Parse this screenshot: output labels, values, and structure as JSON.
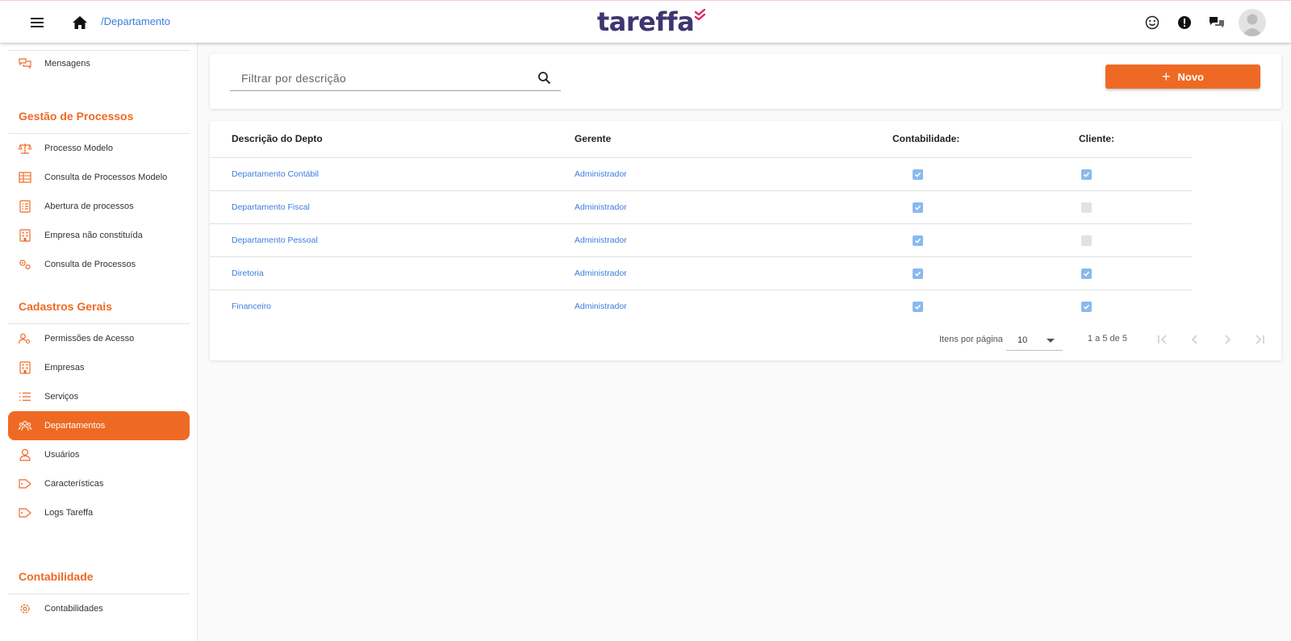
{
  "header": {
    "breadcrumb": "/Departamento",
    "logo_text": "tareffa",
    "icons": [
      "menu-icon",
      "home-icon",
      "smiley-icon",
      "alert-icon",
      "chat-icon",
      "avatar"
    ]
  },
  "sidebar": {
    "top_items": [
      {
        "label": "Mensagens",
        "icon": "chat-bubbles-icon"
      }
    ],
    "sections": [
      {
        "title": "Gestão de Processos",
        "items": [
          {
            "label": "Processo Modelo",
            "icon": "scale-icon"
          },
          {
            "label": "Consulta de Processos Modelo",
            "icon": "table-icon"
          },
          {
            "label": "Abertura de processos",
            "icon": "checklist-icon"
          },
          {
            "label": "Empresa não constituída",
            "icon": "building-icon"
          },
          {
            "label": "Consulta de Processos",
            "icon": "gears-icon"
          }
        ]
      },
      {
        "title": "Cadastros Gerais",
        "items": [
          {
            "label": "Permissões de Acesso",
            "icon": "user-key-icon"
          },
          {
            "label": "Empresas",
            "icon": "building-icon"
          },
          {
            "label": "Serviços",
            "icon": "list-icon"
          },
          {
            "label": "Departamentos",
            "icon": "group-icon",
            "active": true
          },
          {
            "label": "Usuários",
            "icon": "user-icon"
          },
          {
            "label": "Características",
            "icon": "tag-icon"
          },
          {
            "label": "Logs Tareffa",
            "icon": "tag-icon"
          }
        ]
      },
      {
        "title": "Contabilidade",
        "items": [
          {
            "label": "Contabilidades",
            "icon": "gear-icon"
          }
        ]
      }
    ]
  },
  "filter": {
    "placeholder": "Filtrar por descrição",
    "value": "",
    "new_button": "Novo"
  },
  "table": {
    "columns": [
      "Descrição do Depto",
      "Gerente",
      "Contabilidade:",
      "Cliente:"
    ],
    "rows": [
      {
        "descricao": "Departamento Contábil",
        "gerente": "Administrador",
        "contabilidade": true,
        "cliente": true
      },
      {
        "descricao": "Departamento Fiscal",
        "gerente": "Administrador",
        "contabilidade": true,
        "cliente": false
      },
      {
        "descricao": "Departamento Pessoal",
        "gerente": "Administrador",
        "contabilidade": true,
        "cliente": false
      },
      {
        "descricao": "Diretoria",
        "gerente": "Administrador",
        "contabilidade": true,
        "cliente": true
      },
      {
        "descricao": "Financeiro",
        "gerente": "Administrador",
        "contabilidade": true,
        "cliente": true
      }
    ]
  },
  "paginator": {
    "items_per_page_label": "Itens por página",
    "page_size": "10",
    "range": "1 a 5 de 5"
  },
  "colors": {
    "accent": "#ee6a24",
    "link": "#3b7ddd",
    "logo": "#3d3670",
    "logo_check": "#e0246e",
    "checkbox_on": "#8ab9ef",
    "checkbox_off": "#e2e2e2"
  }
}
